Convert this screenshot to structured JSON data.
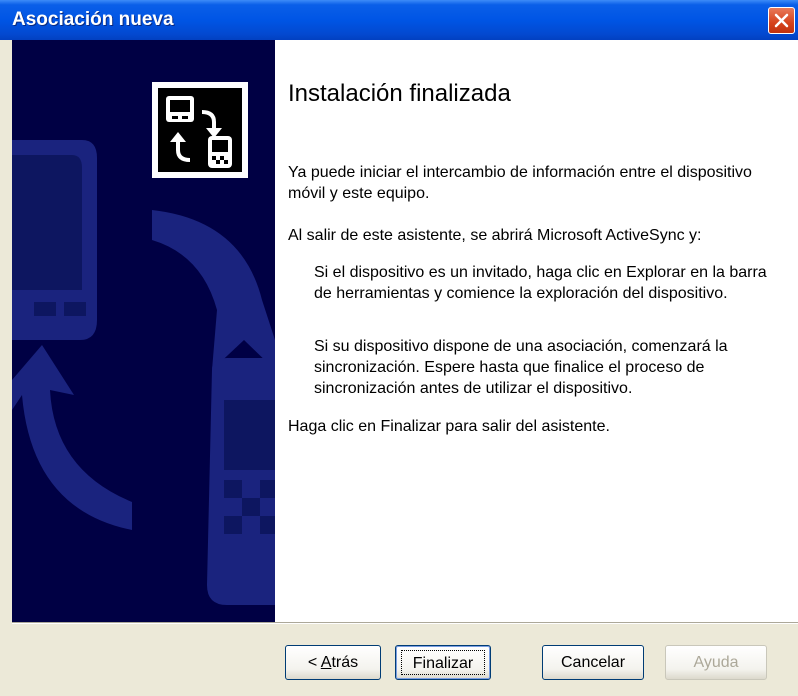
{
  "window": {
    "title": "Asociación nueva",
    "close_icon": "close-icon"
  },
  "banner": {
    "icon": "sync-device-icon",
    "background_color": "#000044",
    "shape_color": "#1a237e"
  },
  "content": {
    "heading": "Instalación finalizada",
    "paragraph_1": "Ya puede iniciar el intercambio de información entre el dispositivo móvil y este equipo.",
    "paragraph_2": "Al salir de este asistente, se abrirá Microsoft ActiveSync y:",
    "indented_1": "Si el dispositivo es un invitado, haga clic en Explorar en la barra de herramientas y comience la exploración del dispositivo.",
    "indented_2": "Si su dispositivo dispone de una asociación, comenzará la sincronización. Espere hasta que finalice el proceso de sincronización antes de utilizar el dispositivo.",
    "paragraph_3": "Haga clic en Finalizar para salir del asistente."
  },
  "buttons": {
    "back": {
      "label_pre": "< ",
      "label_key": "A",
      "label_post": "trás"
    },
    "finish": "Finalizar",
    "cancel": "Cancelar",
    "help": "Ayuda"
  },
  "colors": {
    "titlebar": "#0055e5",
    "close_button": "#d6421c",
    "dialog_face": "#ece9d8"
  }
}
